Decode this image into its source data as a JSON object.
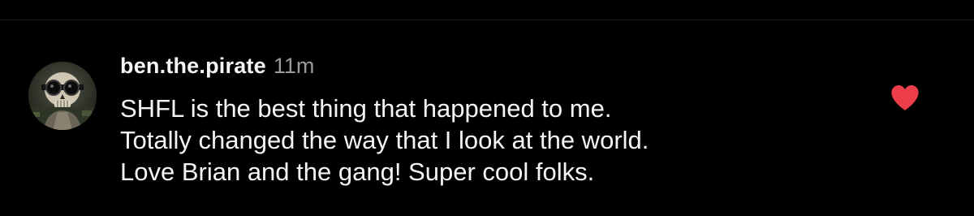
{
  "comment": {
    "username": "ben.the.pirate",
    "timestamp": "11m",
    "text_lines": [
      "SHFL is the best thing that happened to me.",
      "Totally changed the way that I look at the world.",
      "Love Brian and the gang! Super cool folks."
    ],
    "liked": true,
    "like_icon": "heart-icon",
    "avatar_icon": "skull-avatar"
  },
  "colors": {
    "background": "#000000",
    "text": "#f5f5f5",
    "timestamp": "#9a9a9a",
    "like": "#ee3d4a"
  }
}
